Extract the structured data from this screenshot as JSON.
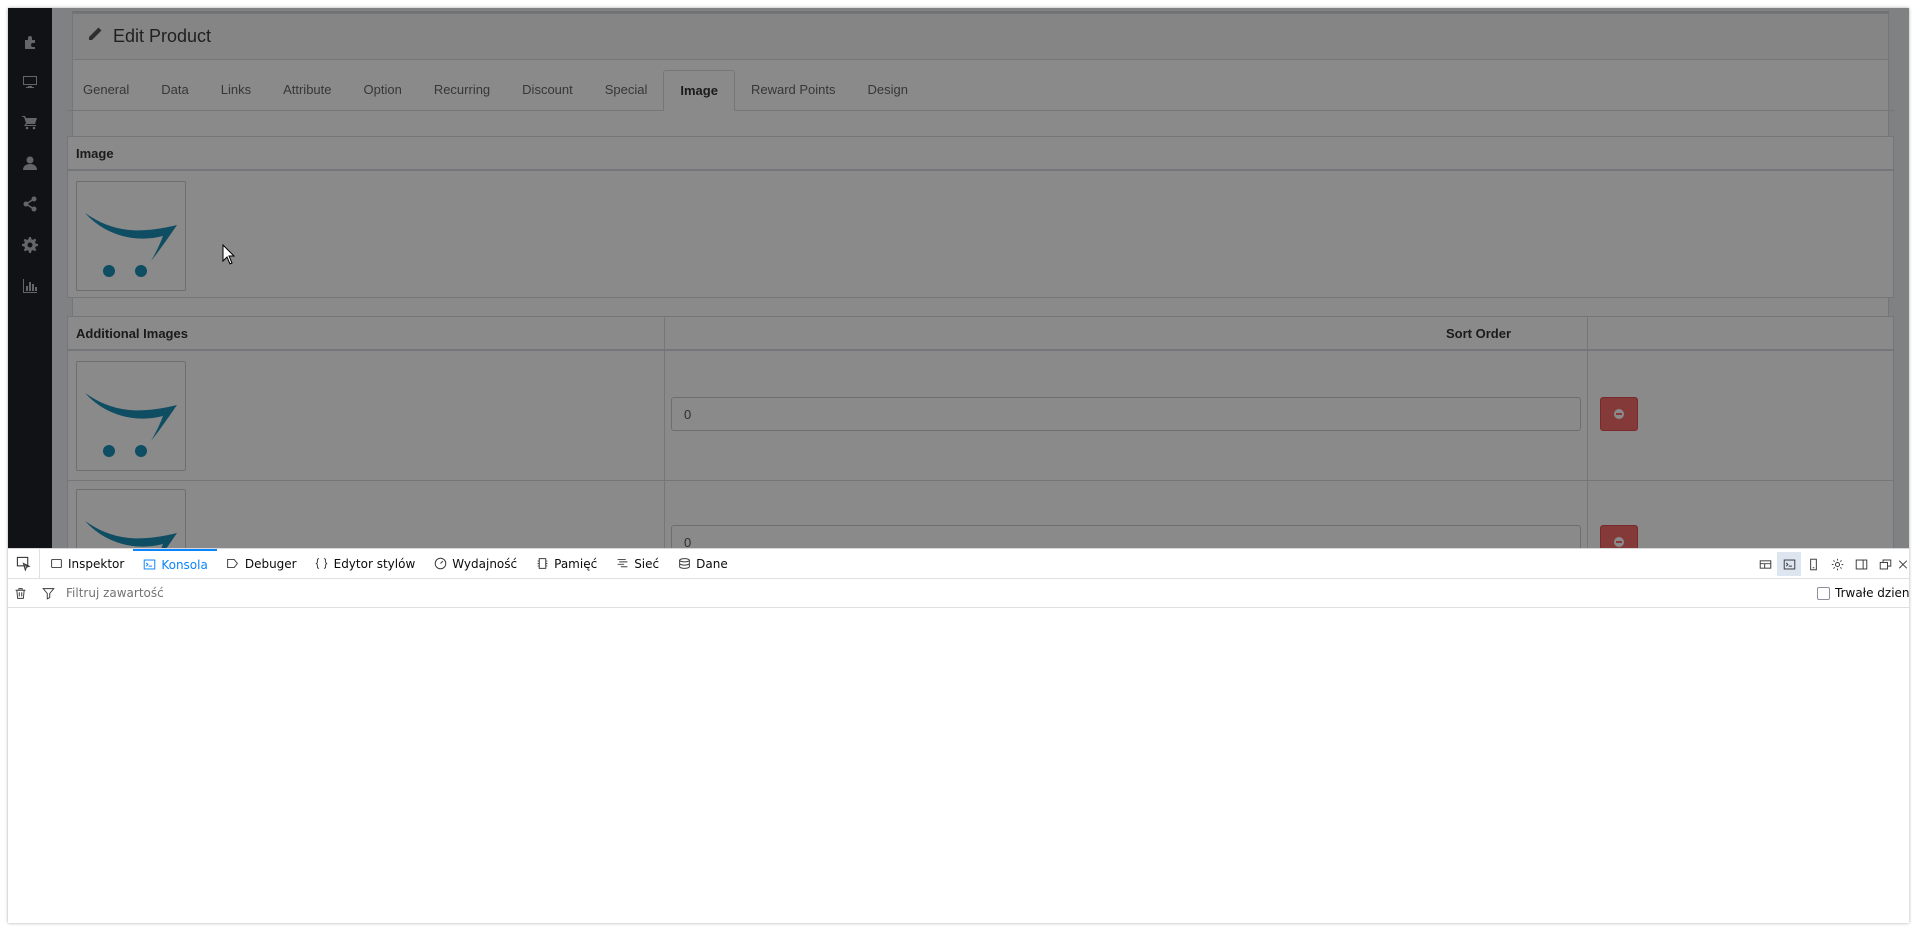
{
  "sidebar": {
    "icons": [
      "puzzle-icon",
      "desktop-icon",
      "cart-icon",
      "user-icon",
      "share-icon",
      "gear-icon",
      "bar-chart-icon"
    ]
  },
  "panel": {
    "title": "Edit Product"
  },
  "tabs": [
    {
      "label": "General"
    },
    {
      "label": "Data"
    },
    {
      "label": "Links"
    },
    {
      "label": "Attribute"
    },
    {
      "label": "Option"
    },
    {
      "label": "Recurring"
    },
    {
      "label": "Discount"
    },
    {
      "label": "Special"
    },
    {
      "label": "Image",
      "active": true
    },
    {
      "label": "Reward Points"
    },
    {
      "label": "Design"
    }
  ],
  "image_section": {
    "header": "Image",
    "logo_color": "#1a8fb5"
  },
  "additional_images": {
    "header_left": "Additional Images",
    "header_sort": "Sort Order",
    "rows": [
      {
        "sort_order": "0"
      },
      {
        "sort_order": "0"
      }
    ]
  },
  "devtools": {
    "tabs": [
      {
        "label": "Inspektor",
        "icon": "inspector-icon"
      },
      {
        "label": "Konsola",
        "icon": "console-icon",
        "active": true
      },
      {
        "label": "Debuger",
        "icon": "debugger-icon"
      },
      {
        "label": "Edytor stylów",
        "icon": "style-editor-icon"
      },
      {
        "label": "Wydajność",
        "icon": "performance-icon"
      },
      {
        "label": "Pamięć",
        "icon": "memory-icon"
      },
      {
        "label": "Sieć",
        "icon": "network-icon"
      },
      {
        "label": "Dane",
        "icon": "storage-icon"
      }
    ],
    "filter_placeholder": "Filtruj zawartość",
    "persist_logs_label": "Trwałe dzienniki",
    "accent_color": "#0a84ff"
  }
}
